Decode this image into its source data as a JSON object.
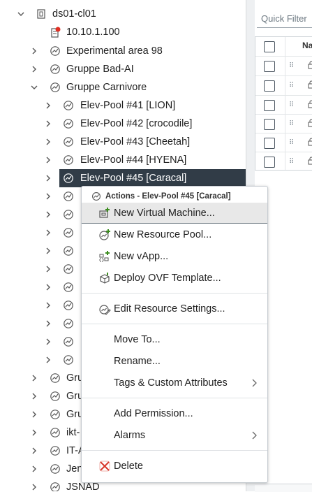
{
  "tree": {
    "cluster": {
      "label": "ds01-cl01"
    },
    "host": {
      "label": "10.10.1.100"
    },
    "groups": [
      {
        "label": "Experimental area 98"
      },
      {
        "label": "Gruppe Bad-AI"
      },
      {
        "label": "Gruppe Carnivore"
      }
    ],
    "pools": [
      {
        "label": "Elev-Pool #41 [LION]"
      },
      {
        "label": "Elev-Pool #42 [crocodile]"
      },
      {
        "label": "Elev-Pool #43 [Cheetah]"
      },
      {
        "label": "Elev-Pool #44 [HYENA]"
      },
      {
        "label": "Elev-Pool #45 [Caracal]"
      }
    ],
    "lower_groups": [
      {
        "label": "Gru"
      },
      {
        "label": "Gru"
      },
      {
        "label": "Gru"
      },
      {
        "label": "ikt-"
      },
      {
        "label": "IT-A"
      },
      {
        "label": "Jen"
      },
      {
        "label": "JSNAD"
      }
    ]
  },
  "right_panel": {
    "quick_filter_placeholder": "Quick Filter",
    "column_header": "Na"
  },
  "context_menu": {
    "title": "Actions - Elev-Pool #45 [Caracal]",
    "items": [
      {
        "label": "New Virtual Machine...",
        "icon": "new-vm-icon"
      },
      {
        "label": "New Resource Pool...",
        "icon": "new-resource-pool-icon"
      },
      {
        "label": "New vApp...",
        "icon": "new-vapp-icon"
      },
      {
        "label": "Deploy OVF Template...",
        "icon": "deploy-ovf-icon"
      },
      {
        "label": "Edit Resource Settings...",
        "icon": "edit-resource-settings-icon"
      },
      {
        "label": "Move To..."
      },
      {
        "label": "Rename..."
      },
      {
        "label": "Tags & Custom Attributes",
        "submenu": true
      },
      {
        "label": "Add Permission..."
      },
      {
        "label": "Alarms",
        "submenu": true
      },
      {
        "label": "Delete",
        "icon": "delete-icon"
      }
    ]
  },
  "colors": {
    "selected_row": "#313c47",
    "accent_green": "#3c8d1f",
    "delete_red": "#d8372a",
    "host_alert": "#e02f23"
  }
}
